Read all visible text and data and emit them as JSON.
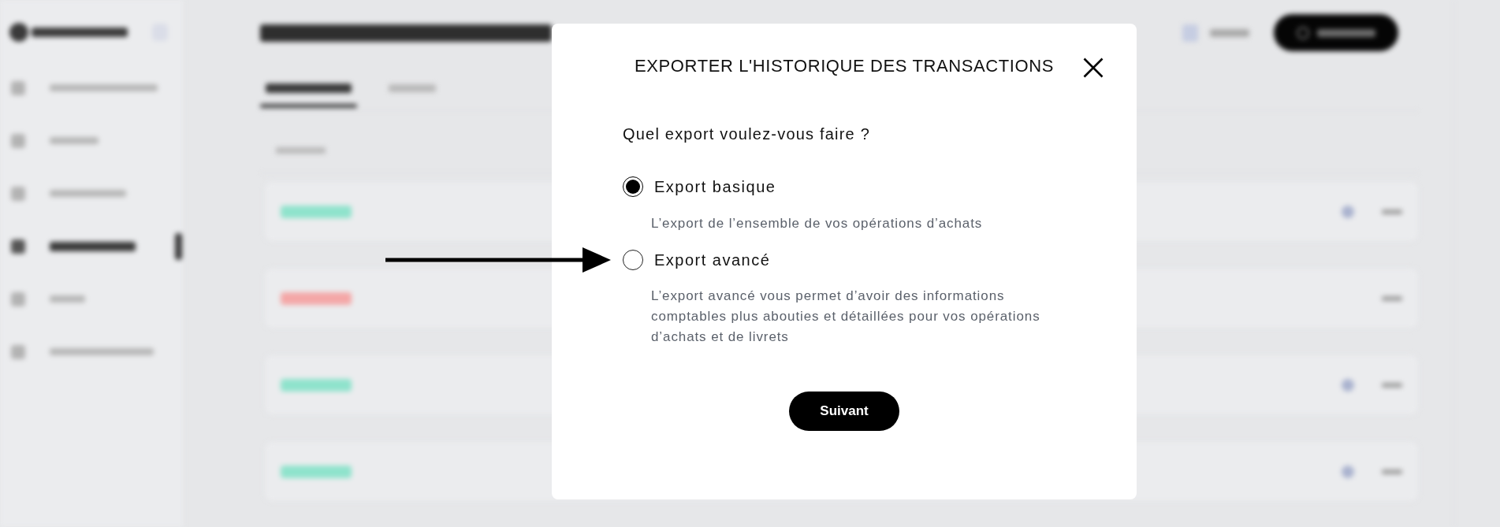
{
  "backdrop": {
    "nav": [
      {
        "selected": false
      },
      {
        "selected": false
      },
      {
        "selected": false
      },
      {
        "selected": true
      },
      {
        "selected": false
      },
      {
        "selected": false
      }
    ],
    "tabs": [
      {
        "selected": true
      },
      {
        "selected": false
      }
    ],
    "rows": [
      {
        "color": "#8fe3cc",
        "has_icon": true
      },
      {
        "color": "#f4a7a7",
        "has_icon": false
      },
      {
        "color": "#8fe3cc",
        "has_icon": true
      },
      {
        "color": "#8fe3cc",
        "has_icon": true
      }
    ]
  },
  "dialog": {
    "title": "EXPORTER L'HISTORIQUE DES TRANSACTIONS",
    "question": "Quel export voulez-vous faire ?",
    "options": [
      {
        "label": "Export basique",
        "description": "L’export de l’ensemble de vos opérations d’achats",
        "selected": true,
        "pointed_by_arrow": false
      },
      {
        "label": "Export avancé",
        "description": "L’export avancé vous permet d’avoir des informations comptables plus abouties et détaillées pour vos opérations d’achats et de livrets",
        "selected": false,
        "pointed_by_arrow": true
      }
    ],
    "button": "Suivant"
  }
}
